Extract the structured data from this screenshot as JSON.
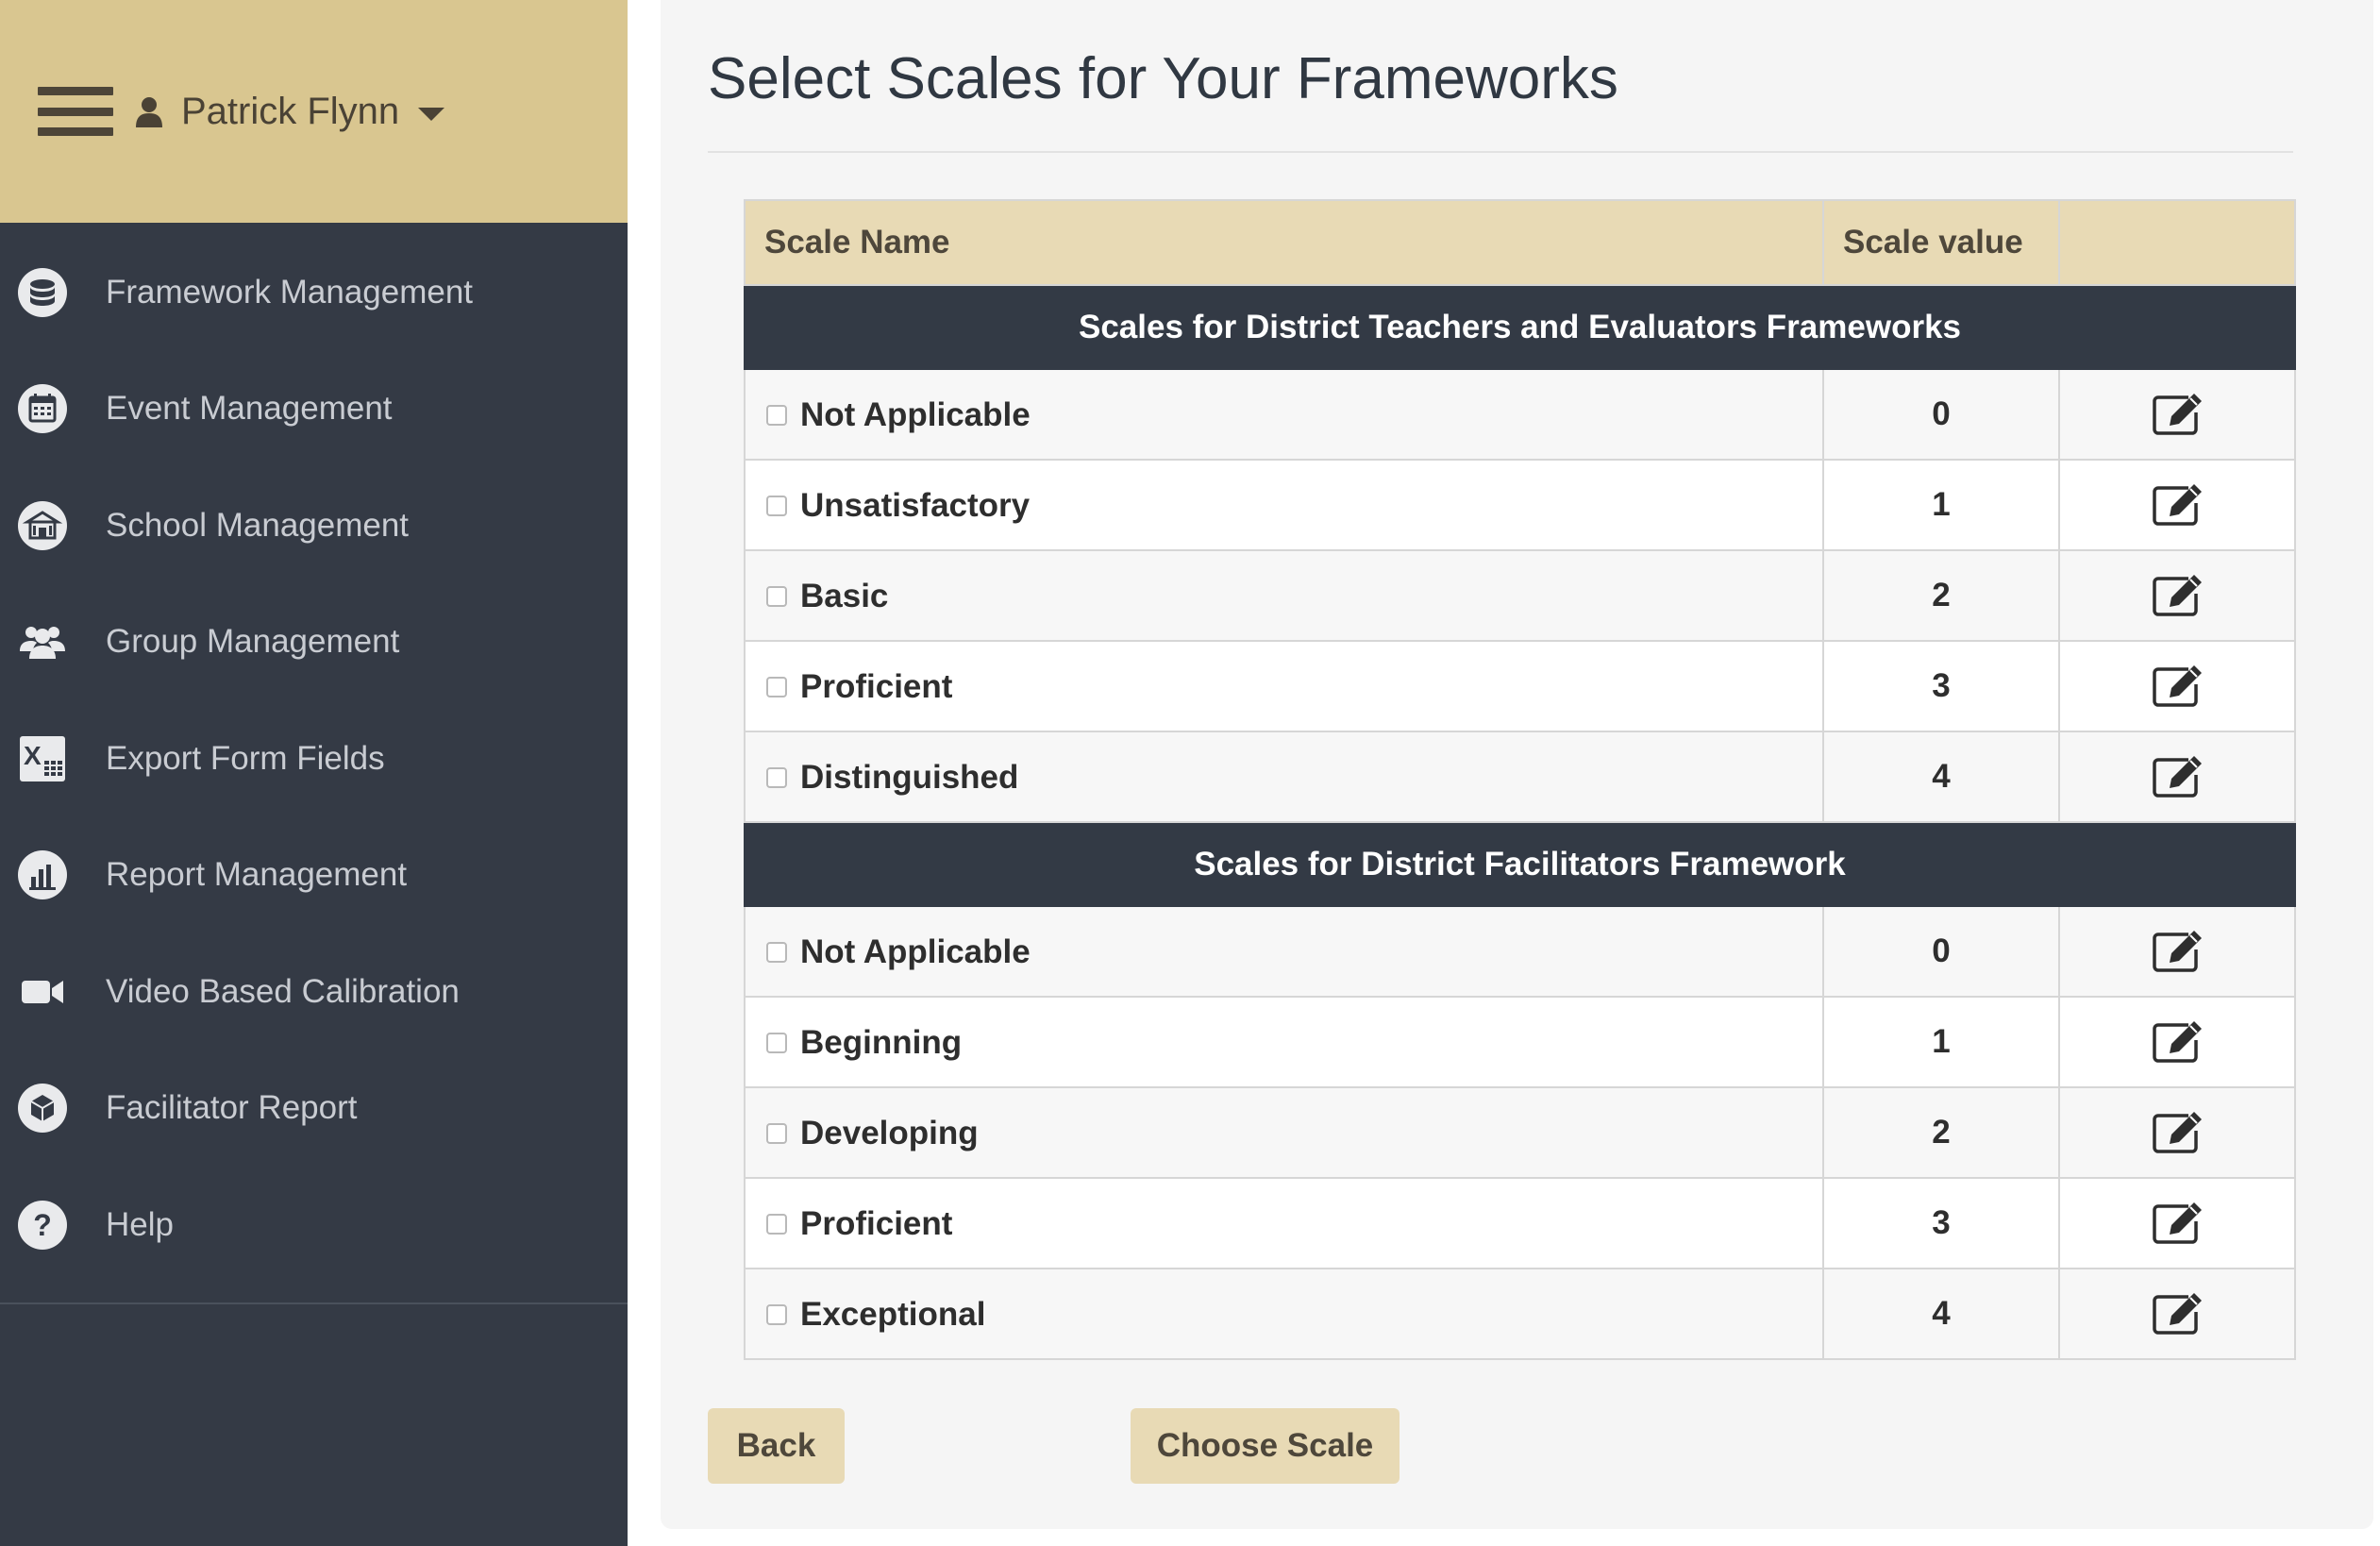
{
  "sidebar": {
    "user_name": "Patrick Flynn",
    "items": [
      {
        "label": "Framework Management",
        "icon": "database-icon"
      },
      {
        "label": "Event Management",
        "icon": "calendar-icon"
      },
      {
        "label": "School Management",
        "icon": "school-icon"
      },
      {
        "label": "Group Management",
        "icon": "users-icon"
      },
      {
        "label": "Export Form Fields",
        "icon": "excel-icon"
      },
      {
        "label": "Report Management",
        "icon": "bar-chart-icon"
      },
      {
        "label": "Video Based Calibration",
        "icon": "video-camera-icon"
      },
      {
        "label": "Facilitator Report",
        "icon": "report-cube-icon"
      },
      {
        "label": "Help",
        "icon": "question-icon"
      }
    ]
  },
  "main": {
    "title": "Select Scales for Your Frameworks",
    "table": {
      "headers": {
        "name": "Scale Name",
        "value": "Scale value",
        "actions": ""
      },
      "groups": [
        {
          "title": "Scales for District Teachers and Evaluators Frameworks",
          "rows": [
            {
              "name": "Not Applicable",
              "value": "0"
            },
            {
              "name": "Unsatisfactory",
              "value": "1"
            },
            {
              "name": "Basic",
              "value": "2"
            },
            {
              "name": "Proficient",
              "value": "3"
            },
            {
              "name": "Distinguished",
              "value": "4"
            }
          ]
        },
        {
          "title": "Scales for District Facilitators Framework",
          "rows": [
            {
              "name": "Not Applicable",
              "value": "0"
            },
            {
              "name": "Beginning",
              "value": "1"
            },
            {
              "name": "Developing",
              "value": "2"
            },
            {
              "name": "Proficient",
              "value": "3"
            },
            {
              "name": "Exceptional",
              "value": "4"
            }
          ]
        }
      ]
    },
    "buttons": {
      "back": "Back",
      "choose": "Choose Scale"
    }
  },
  "colors": {
    "sidebar_bg": "#343a45",
    "header_gold": "#d9c690",
    "table_header": "#e8dab5",
    "group_row": "#333a45"
  }
}
